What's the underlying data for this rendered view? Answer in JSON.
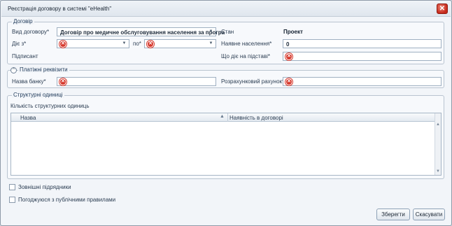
{
  "window": {
    "title": "Реєстрація договору в системі \"eHealth\""
  },
  "contract": {
    "group_title": "Договір",
    "type_label": "Вид договору*",
    "type_value": "Договір про медичне обслуговування населення за програ",
    "state_label": "Стан",
    "state_value": "Проект",
    "valid_from_label": "Діє з*",
    "valid_to_label": "по*",
    "population_label": "Наявне населення*",
    "population_value": "0",
    "signer_label": "Підписант",
    "basis_label": "Що діє на підставі*"
  },
  "payment": {
    "group_title": "Платіжні реквізити",
    "bank_label": "Назва банку*",
    "account_label": "Розрахунковий рахунок*"
  },
  "units": {
    "group_title": "Структурні одиниці",
    "count_label": "Кількість структурних одиниць",
    "columns": [
      "Назва",
      "Наявність в договорі"
    ]
  },
  "options": {
    "subcontractors_label": "Зовнішні підрядники",
    "public_rules_label": "Погоджуюся з публічними правилами"
  },
  "buttons": {
    "save": "Зберегти",
    "cancel": "Скасувати"
  },
  "icons": {
    "error": "error-icon",
    "close": "close-icon"
  }
}
